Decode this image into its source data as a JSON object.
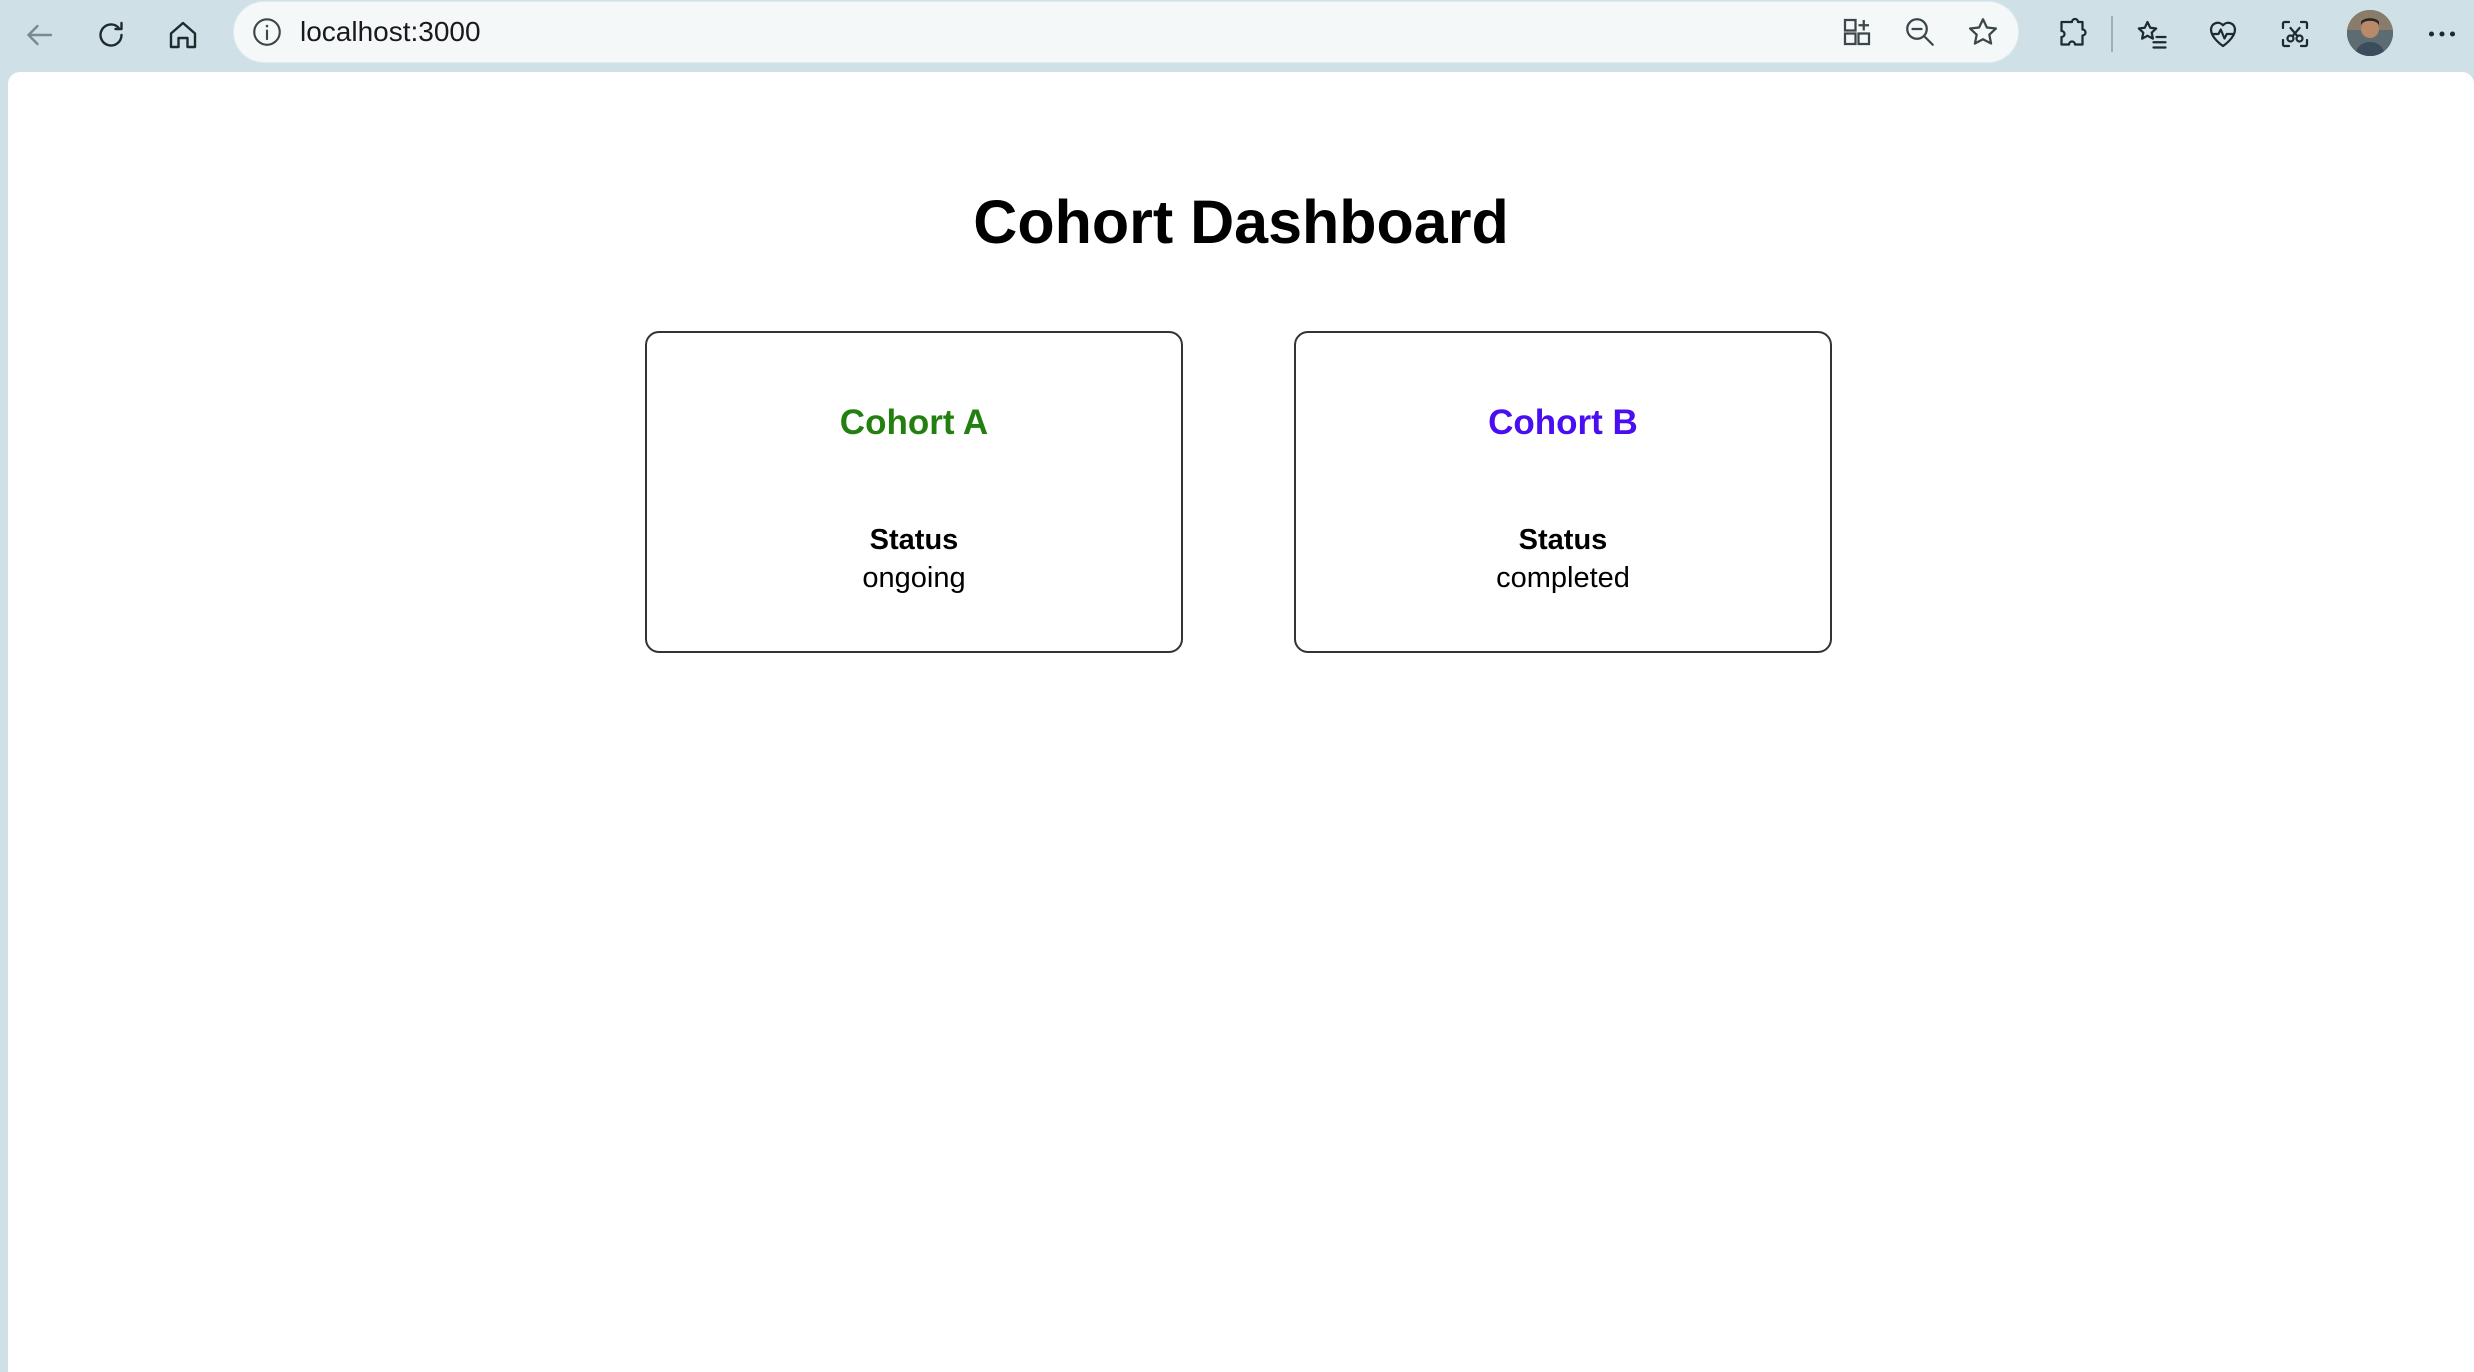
{
  "browser": {
    "url": "localhost:3000",
    "icons": [
      "back-arrow-icon",
      "reload-icon",
      "home-icon",
      "info-icon",
      "app-grid-icon",
      "zoom-out-icon",
      "favorite-star-icon",
      "extensions-icon",
      "favorites-list-icon",
      "health-heart-icon",
      "screenshot-icon",
      "profile-avatar",
      "more-menu-icon"
    ]
  },
  "page": {
    "title": "Cohort Dashboard"
  },
  "cohorts": [
    {
      "name": "Cohort A",
      "status_label": "Status",
      "status": "ongoing",
      "color": "#238010"
    },
    {
      "name": "Cohort B",
      "status_label": "Status",
      "status": "completed",
      "color": "#4a0ff0"
    }
  ]
}
